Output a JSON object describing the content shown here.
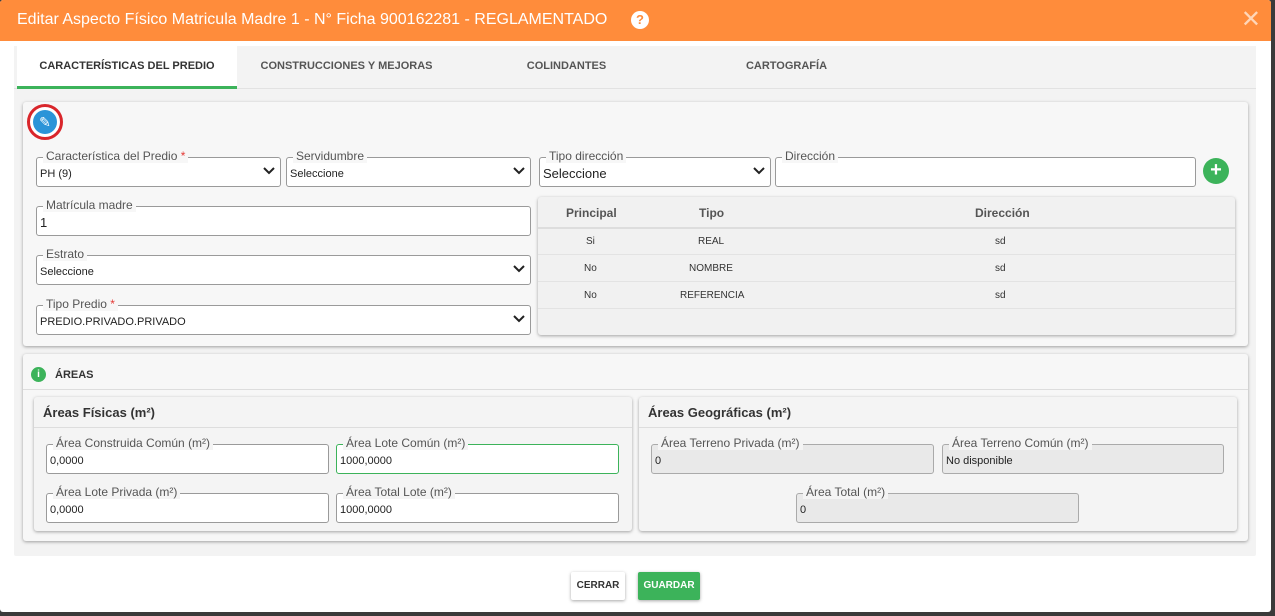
{
  "modal": {
    "title": "Editar Aspecto Físico Matricula Madre 1 - N° Ficha 900162281 - REGLAMENTADO",
    "help_glyph": "?",
    "close_glyph": "✕"
  },
  "tabs": [
    {
      "label": "CARACTERÍSTICAS DEL PREDIO",
      "active": true
    },
    {
      "label": "CONSTRUCCIONES Y MEJORAS",
      "active": false
    },
    {
      "label": "COLINDANTES",
      "active": false
    },
    {
      "label": "CARTOGRAFÍA",
      "active": false
    }
  ],
  "predio": {
    "caracteristica": {
      "label": "Característica del Predio",
      "required": "*",
      "value": "PH (9)"
    },
    "servidumbre": {
      "label": "Servidumbre",
      "value": "Seleccione"
    },
    "tipo_direccion": {
      "label": "Tipo dirección",
      "value": "Seleccione"
    },
    "direccion": {
      "label": "Dirección",
      "value": ""
    },
    "matricula": {
      "label": "Matrícula madre",
      "value": "1"
    },
    "estrato": {
      "label": "Estrato",
      "value": "Seleccione"
    },
    "tipo_predio": {
      "label": "Tipo Predio",
      "required": "*",
      "value": "PREDIO.PRIVADO.PRIVADO"
    }
  },
  "address_table": {
    "headers": [
      "Principal",
      "Tipo",
      "Dirección"
    ],
    "rows": [
      [
        "Si",
        "REAL",
        "sd"
      ],
      [
        "No",
        "NOMBRE",
        "sd"
      ],
      [
        "No",
        "REFERENCIA",
        "sd"
      ]
    ]
  },
  "areas": {
    "title": "ÁREAS",
    "fisicas": {
      "title": "Áreas Físicas (m²)",
      "construida_comun": {
        "label": "Área Construida Común (m²)",
        "value": "0,0000"
      },
      "lote_comun": {
        "label": "Área Lote Común (m²)",
        "value": "1000,0000"
      },
      "lote_privada": {
        "label": "Área Lote Privada (m²)",
        "value": "0,0000"
      },
      "total_lote": {
        "label": "Área Total Lote (m²)",
        "value": "1000,0000"
      }
    },
    "geograficas": {
      "title": "Áreas Geográficas (m²)",
      "terreno_privada": {
        "label": "Área Terreno Privada (m²)",
        "value": "0"
      },
      "terreno_comun": {
        "label": "Área Terreno Común (m²)",
        "value": "No disponible"
      },
      "total": {
        "label": "Área Total (m²)",
        "value": "0"
      }
    }
  },
  "buttons": {
    "close": "CERRAR",
    "save": "GUARDAR"
  },
  "colors": {
    "header": "#ff8c3b",
    "accent_green": "#3cb35a",
    "edit_blue": "#2b94d8",
    "edit_ring": "#d9262b"
  },
  "icons": {
    "edit": "pencil-icon",
    "add": "plus-icon",
    "info": "info-icon",
    "help": "question-icon",
    "close": "close-icon"
  }
}
